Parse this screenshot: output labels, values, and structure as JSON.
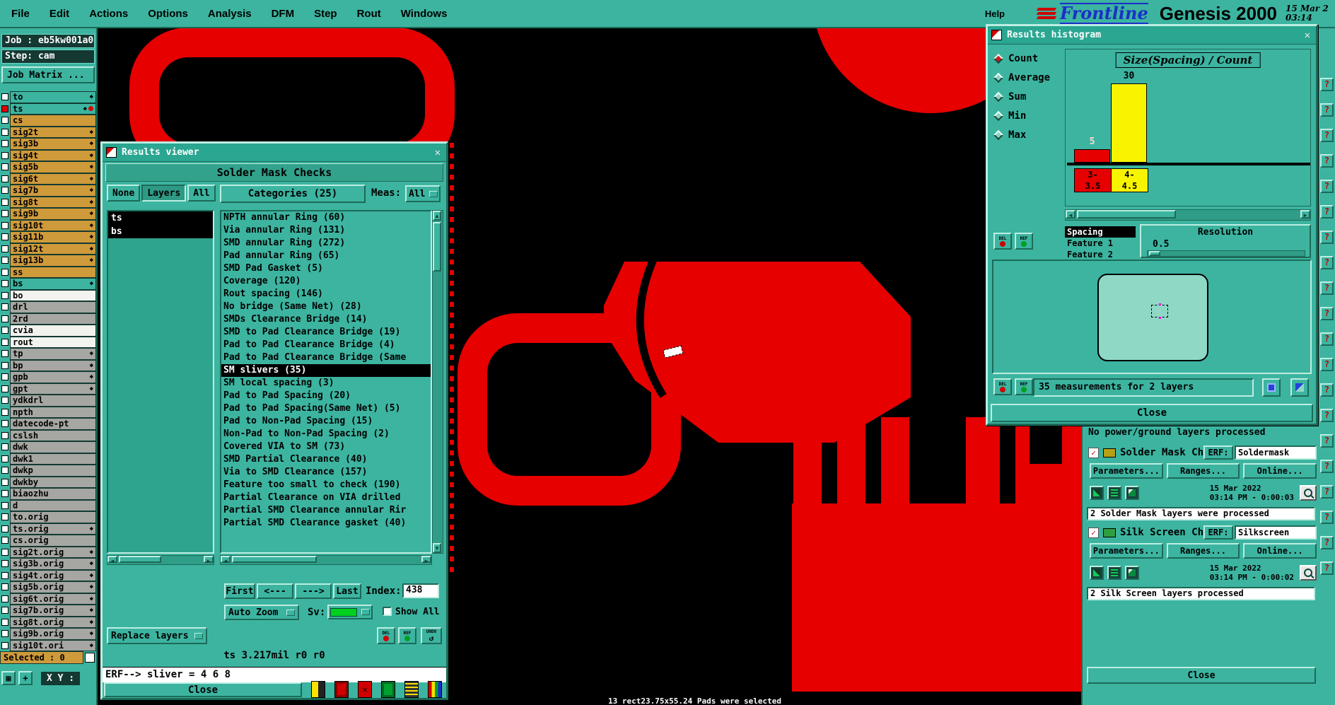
{
  "colors": {
    "teal": "#3cb4a0",
    "teal_dark": "#1c6a58",
    "teal_light": "#bdeee2",
    "gold": "#cf9a3a",
    "pcb_red": "#e60000",
    "bar_yellow": "#f8f400",
    "sv_green": "#00d020",
    "magenta": "#ff00ff"
  },
  "icons": {
    "close_x": "✕",
    "diamond": "◆",
    "check": "✓",
    "arrow_up": "▲",
    "arrow_down": "▼",
    "arrow_left": "◄",
    "arrow_right": "►",
    "undo": "↺",
    "grid": "▦",
    "crosshair": "+",
    "x_mark": "✕",
    "help": "?"
  },
  "menu_bar": {
    "items": [
      "File",
      "Edit",
      "Actions",
      "Options",
      "Analysis",
      "DFM",
      "Step",
      "Rout",
      "Windows"
    ],
    "help": "Help",
    "brand": "Frontline",
    "product": "Genesis 2000",
    "date": "15 Mar 2",
    "time": "03:14"
  },
  "left_panel": {
    "job": "Job : eb5kw001a0",
    "step": "Step: cam",
    "job_matrix": "Job Matrix ...",
    "selected": "Selected : 0",
    "xy": "X Y :",
    "layers": [
      {
        "name": "to",
        "type": "teal",
        "diamond": true
      },
      {
        "name": "ts",
        "type": "teal",
        "diamond": true,
        "active": true
      },
      {
        "name": "cs",
        "type": "gold",
        "diamond": false
      },
      {
        "name": "sig2t",
        "type": "gold",
        "diamond": true
      },
      {
        "name": "sig3b",
        "type": "gold",
        "diamond": true
      },
      {
        "name": "sig4t",
        "type": "gold",
        "diamond": true
      },
      {
        "name": "sig5b",
        "type": "gold",
        "diamond": true
      },
      {
        "name": "sig6t",
        "type": "gold",
        "diamond": true
      },
      {
        "name": "sig7b",
        "type": "gold",
        "diamond": true
      },
      {
        "name": "sig8t",
        "type": "gold",
        "diamond": true
      },
      {
        "name": "sig9b",
        "type": "gold",
        "diamond": true
      },
      {
        "name": "sig10t",
        "type": "gold",
        "diamond": true
      },
      {
        "name": "sig11b",
        "type": "gold",
        "diamond": true
      },
      {
        "name": "sig12t",
        "type": "gold",
        "diamond": true
      },
      {
        "name": "sig13b",
        "type": "gold",
        "diamond": true
      },
      {
        "name": "ss",
        "type": "gold",
        "diamond": false
      },
      {
        "name": "bs",
        "type": "teal",
        "diamond": true
      },
      {
        "name": "bo",
        "type": "white",
        "diamond": false
      },
      {
        "name": "drl",
        "type": "gray",
        "diamond": false
      },
      {
        "name": "2rd",
        "type": "gray",
        "diamond": false
      },
      {
        "name": "cvia",
        "type": "white",
        "diamond": false
      },
      {
        "name": "rout",
        "type": "white",
        "diamond": false
      },
      {
        "name": "tp",
        "type": "gray",
        "diamond": true
      },
      {
        "name": "bp",
        "type": "gray",
        "diamond": true
      },
      {
        "name": "gpb",
        "type": "gray",
        "diamond": true
      },
      {
        "name": "gpt",
        "type": "gray",
        "diamond": true
      },
      {
        "name": "ydkdrl",
        "type": "gray",
        "diamond": false
      },
      {
        "name": "npth",
        "type": "gray",
        "diamond": false
      },
      {
        "name": "datecode-pt",
        "type": "gray",
        "diamond": false
      },
      {
        "name": "cslsh",
        "type": "gray",
        "diamond": false
      },
      {
        "name": "dwk",
        "type": "gray",
        "diamond": false
      },
      {
        "name": "dwk1",
        "type": "gray",
        "diamond": false
      },
      {
        "name": "dwkp",
        "type": "gray",
        "diamond": false
      },
      {
        "name": "dwkby",
        "type": "gray",
        "diamond": false
      },
      {
        "name": "biaozhu",
        "type": "gray",
        "diamond": false
      },
      {
        "name": "d",
        "type": "gray",
        "diamond": false
      },
      {
        "name": "to.orig",
        "type": "gray",
        "diamond": false
      },
      {
        "name": "ts.orig",
        "type": "gray",
        "diamond": true
      },
      {
        "name": "cs.orig",
        "type": "gray",
        "diamond": false
      },
      {
        "name": "sig2t.orig",
        "type": "gray",
        "diamond": true
      },
      {
        "name": "sig3b.orig",
        "type": "gray",
        "diamond": true
      },
      {
        "name": "sig4t.orig",
        "type": "gray",
        "diamond": true
      },
      {
        "name": "sig5b.orig",
        "type": "gray",
        "diamond": true
      },
      {
        "name": "sig6t.orig",
        "type": "gray",
        "diamond": true
      },
      {
        "name": "sig7b.orig",
        "type": "gray",
        "diamond": true
      },
      {
        "name": "sig8t.orig",
        "type": "gray",
        "diamond": true
      },
      {
        "name": "sig9b.orig",
        "type": "gray",
        "diamond": true
      },
      {
        "name": "sig10t.ori",
        "type": "gray",
        "diamond": true
      }
    ]
  },
  "results_viewer": {
    "title": "Results viewer",
    "header": "Solder Mask Checks",
    "filters": [
      "None",
      "Layers",
      "All"
    ],
    "active_filter": "Layers",
    "categories_header": "Categories (25)",
    "meas_label": "Meas:",
    "meas_value": "All",
    "layers": [
      "ts",
      "bs"
    ],
    "categories": [
      "NPTH annular Ring (60)",
      "Via annular Ring (131)",
      "SMD annular Ring (272)",
      "Pad annular Ring (65)",
      "SMD Pad Gasket (5)",
      "Coverage (120)",
      "Rout spacing (146)",
      "No bridge (Same Net) (28)",
      "SMDs Clearance Bridge (14)",
      "SMD to Pad Clearance Bridge (19)",
      "Pad to Pad Clearance Bridge (4)",
      "Pad to Pad Clearance Bridge (Same",
      "SM slivers (35)",
      "SM local spacing (3)",
      "Pad to Pad Spacing (20)",
      "Pad to Pad Spacing(Same Net) (5)",
      "Pad to Non-Pad Spacing (15)",
      "Non-Pad to Non-Pad Spacing (2)",
      "Covered VIA to SM (73)",
      "SMD Partial Clearance (40)",
      "Via to SMD Clearance (157)",
      "Feature too small to check (190)",
      "Partial Clearance on VIA drilled",
      "Partial SMD Clearance annular Rir",
      "Partial SMD Clearance gasket (40)"
    ],
    "selected_index": 12,
    "nav": {
      "first": "First",
      "prev": "<---",
      "next": "--->",
      "last": "Last",
      "index_label": "Index:",
      "index_value": "438"
    },
    "auto_zoom": "Auto Zoom",
    "sv_label": "Sv:",
    "show_all": "Show All",
    "replace_layers": "Replace layers",
    "tools": [
      "DEL",
      "REF",
      "UNDO"
    ],
    "status": "ts 3.217mil  r0  r0",
    "prompt": "ERF--> sliver = 4 6 8",
    "close": "Close"
  },
  "histogram": {
    "title": "Results histogram",
    "stats": [
      "Count",
      "Average",
      "Sum",
      "Min",
      "Max"
    ],
    "active_stat": "Count",
    "axis_items": [
      "Spacing",
      "Feature 1",
      "Feature 2"
    ],
    "active_axis": "Spacing",
    "resolution_label": "Resolution",
    "resolution_value": "0.5",
    "del_label": "DEL",
    "ref_label": "REF",
    "info": "35 measurements for 2 layers",
    "close": "Close"
  },
  "chart_data": {
    "type": "bar",
    "title": "Size(Spacing) / Count",
    "categories": [
      "3-3.5",
      "4-4.5"
    ],
    "values": [
      5,
      30
    ],
    "bar_colors": [
      "#e60000",
      "#f8f400"
    ],
    "value_label_colors": [
      "#ffd8d8",
      "#000000"
    ],
    "xlabel": "Size (Spacing)",
    "ylabel": "Count",
    "ylim": [
      0,
      30
    ],
    "legend": "none"
  },
  "checklist": {
    "note": "No power/ground layers processed",
    "sections": [
      {
        "name": "Solder Mask Ch",
        "erf_label": "ERF:",
        "erf_value": "Soldermask",
        "buttons": [
          "Parameters...",
          "Ranges...",
          "Online..."
        ],
        "date": "15 Mar 2022",
        "duration": "03:14 PM - 0:00:03",
        "result": "2 Solder Mask layers were processed",
        "icon_color": "#b8a016"
      },
      {
        "name": "Silk Screen Che",
        "erf_label": "ERF:",
        "erf_value": "Silkscreen",
        "buttons": [
          "Parameters...",
          "Ranges...",
          "Online..."
        ],
        "date": "15 Mar 2022",
        "duration": "03:14 PM - 0:00:02",
        "result": "2 Silk Screen layers processed",
        "icon_color": "#2f9e3f"
      }
    ],
    "close": "Close"
  },
  "status_bar": {
    "text": "13 rect23.75x55.24 Pads were selected"
  }
}
